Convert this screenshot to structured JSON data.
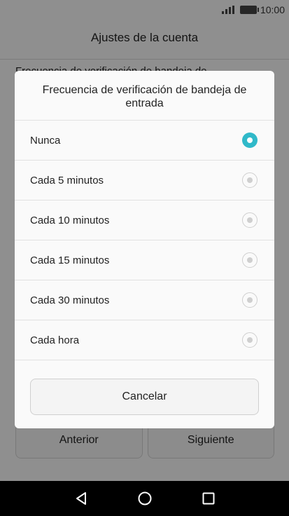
{
  "status_bar": {
    "time": "10:00"
  },
  "background": {
    "app_title": "Ajustes de la cuenta",
    "setting_label": "Frecuencia de verificación de bandeja de",
    "back_button": "Anterior",
    "next_button": "Siguiente"
  },
  "dialog": {
    "title": "Frecuencia de verificación de bandeja de entrada",
    "options": [
      {
        "label": "Nunca",
        "selected": true
      },
      {
        "label": "Cada 5 minutos",
        "selected": false
      },
      {
        "label": "Cada 10 minutos",
        "selected": false
      },
      {
        "label": "Cada 15 minutos",
        "selected": false
      },
      {
        "label": "Cada 30 minutos",
        "selected": false
      },
      {
        "label": "Cada hora",
        "selected": false
      }
    ],
    "cancel_label": "Cancelar"
  },
  "colors": {
    "accent": "#30b9c9"
  },
  "icons": {
    "status": [
      "signal-icon",
      "battery-icon"
    ],
    "nav": [
      "back-icon",
      "home-icon",
      "recents-icon"
    ]
  }
}
